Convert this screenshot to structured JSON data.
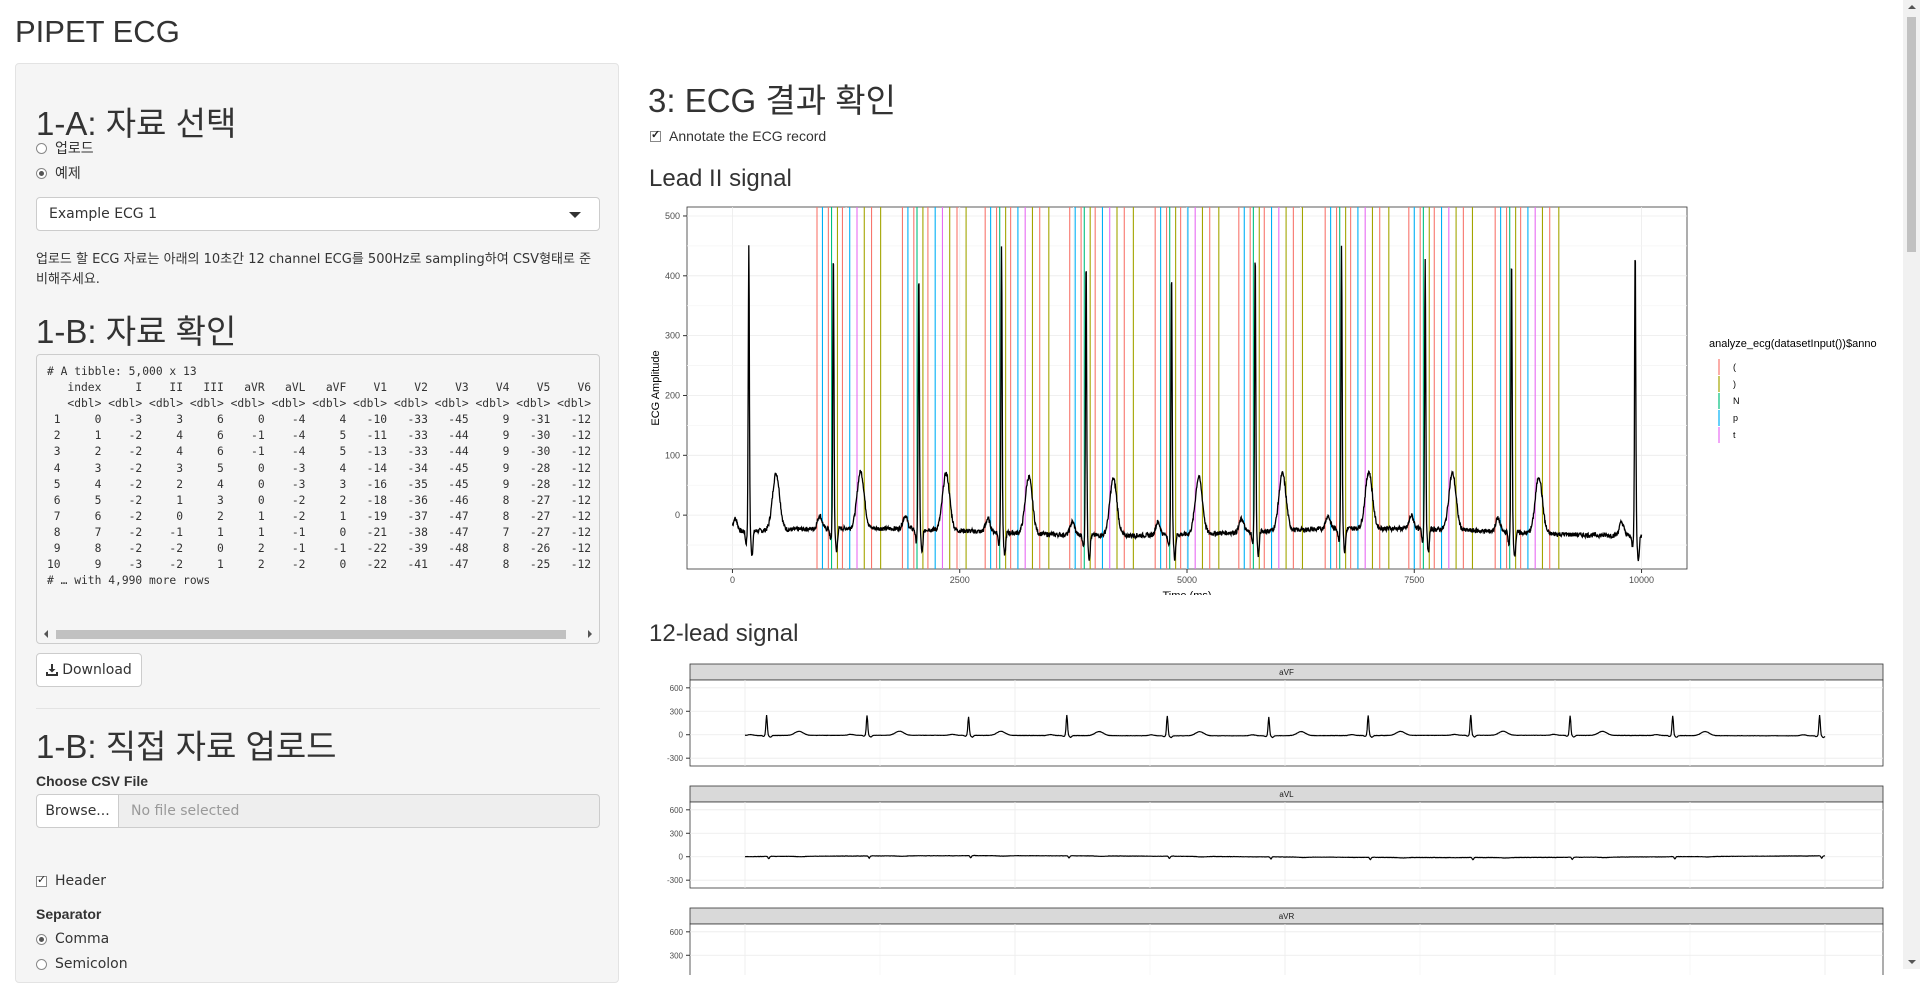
{
  "app": {
    "title": "PIPET ECG"
  },
  "sidebar": {
    "section_1a": {
      "title": "1-A: 자료 선택",
      "radio_upload": "업로드",
      "radio_example": "예제",
      "selected_dataset": "Example ECG 1",
      "help_text": "업로드 할 ECG 자료는 아래의 10초간 12 channel ECG를 500Hz로 sampling하여 CSV형태로 준비해주세요."
    },
    "section_1b": {
      "title": "1-B: 자료 확인",
      "tibble_lines": [
        "# A tibble: 5,000 x 13",
        "   index     I    II   III   aVR   aVL   aVF    V1    V2    V3    V4    V5    V6",
        "   <dbl> <dbl> <dbl> <dbl> <dbl> <dbl> <dbl> <dbl> <dbl> <dbl> <dbl> <dbl> <dbl>",
        " 1     0    -3     3     6     0    -4     4   -10   -33   -45     9   -31   -12",
        " 2     1    -2     4     6    -1    -4     5   -11   -33   -44     9   -30   -12",
        " 3     2    -2     4     6    -1    -4     5   -13   -33   -44     9   -30   -12",
        " 4     3    -2     3     5     0    -3     4   -14   -34   -45     9   -28   -12",
        " 5     4    -2     2     4     0    -3     3   -16   -35   -45     9   -28   -12",
        " 6     5    -2     1     3     0    -2     2   -18   -36   -46     8   -27   -12",
        " 7     6    -2     0     2     1    -2     1   -19   -37   -47     8   -27   -12",
        " 8     7    -2    -1     1     1    -1     0   -21   -38   -47     7   -27   -12",
        " 9     8    -2    -2     0     2    -1    -1   -22   -39   -48     8   -26   -12",
        "10     9    -3    -2     1     2    -2     0   -22   -41   -47     8   -25   -12",
        "# … with 4,990 more rows"
      ],
      "download_label": "Download"
    },
    "section_upload": {
      "title": "1-B: 직접 자료 업로드",
      "choose_label": "Choose CSV File",
      "browse_label": "Browse...",
      "file_placeholder": "No file selected",
      "header_label": "Header",
      "separator_label": "Separator",
      "sep_comma": "Comma",
      "sep_semicolon": "Semicolon"
    }
  },
  "main": {
    "title": "3: ECG 결과 확인",
    "annotate_label": "Annotate the ECG record",
    "lead2_title": "Lead II signal",
    "lead12_title": "12-lead signal"
  },
  "chart_data": [
    {
      "type": "line",
      "xlabel": "Time (ms)",
      "ylabel": "ECG Amplitude",
      "xlim": [
        -500,
        10500
      ],
      "ylim": [
        -90,
        515
      ],
      "x_ticks": [
        0,
        2500,
        5000,
        7500,
        10000
      ],
      "y_ticks": [
        0,
        100,
        200,
        300,
        400,
        500
      ],
      "beats_ms": [
        180,
        1110,
        2050,
        2960,
        3890,
        4830,
        5750,
        6700,
        7620,
        8570,
        9930
      ],
      "beat_peaks": [
        475,
        465,
        430,
        480,
        465,
        440,
        470,
        475,
        455,
        460,
        485
      ],
      "legend_title": "analyze_ecg(datasetInput())$anno",
      "legend_items": [
        {
          "label": "(",
          "color": "#F8766D"
        },
        {
          "label": ")",
          "color": "#A3A500"
        },
        {
          "label": "N",
          "color": "#00BF7D"
        },
        {
          "label": "p",
          "color": "#00B0F6"
        },
        {
          "label": "t",
          "color": "#E76BF3"
        }
      ],
      "grid": true
    },
    {
      "type": "line",
      "panels": [
        {
          "name": "aVF",
          "amp": 1.0,
          "baseline": -5
        },
        {
          "name": "aVL",
          "amp": -0.18,
          "baseline": 0
        },
        {
          "name": "aVR",
          "amp": -0.7,
          "baseline": 0
        }
      ],
      "y_ticks": [
        -300,
        0,
        300,
        600
      ],
      "grid": true
    }
  ]
}
